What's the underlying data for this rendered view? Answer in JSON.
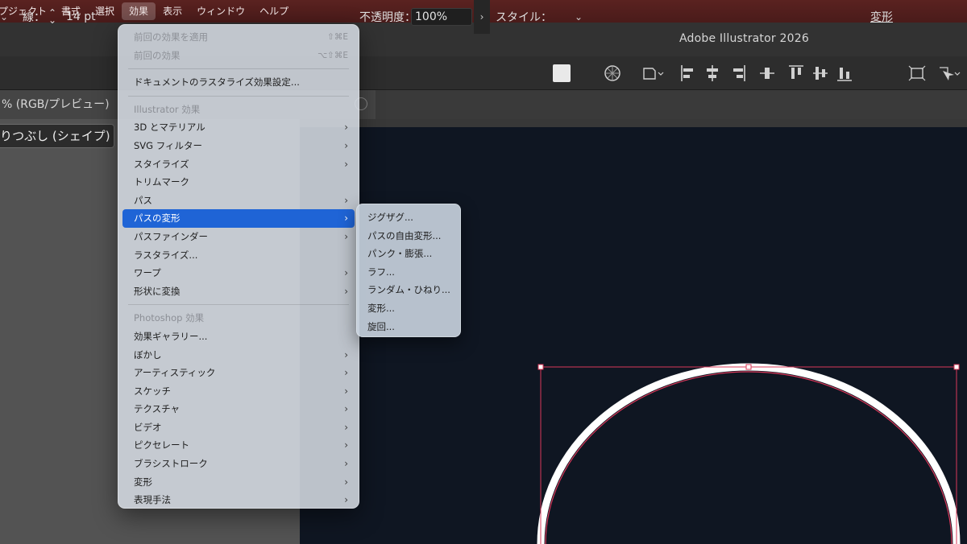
{
  "menubar": {
    "items": [
      {
        "label": "プジェクト",
        "active": false
      },
      {
        "label": "書式",
        "active": false
      },
      {
        "label": "選択",
        "active": false
      },
      {
        "label": "効果",
        "active": true
      },
      {
        "label": "表示",
        "active": false
      },
      {
        "label": "ウィンドウ",
        "active": false
      },
      {
        "label": "ヘルプ",
        "active": false
      }
    ]
  },
  "titlebar": {
    "app_title": "Adobe Illustrator 2026"
  },
  "controlbar": {
    "stroke_label": "線：",
    "stroke_value": "14 pt",
    "opacity_label": "不透明度：",
    "opacity_value": "100%",
    "style_label": "スタイル：",
    "transform_label": "変形"
  },
  "document_tab": {
    "title": "% (RGB/プレビュー)"
  },
  "left_panel": {
    "shape_chip": "りつぶし (シェイプ)"
  },
  "effect_menu": {
    "apply_last": "前回の効果を適用",
    "apply_last_shortcut": "⇧⌘E",
    "last_effect": "前回の効果",
    "last_effect_shortcut": "⌥⇧⌘E",
    "raster_settings": "ドキュメントのラスタライズ効果設定...",
    "illustrator_header": "Illustrator 効果",
    "illustrator_items": [
      {
        "label": "3D とマテリアル",
        "submenu": true
      },
      {
        "label": "SVG フィルター",
        "submenu": true
      },
      {
        "label": "スタイライズ",
        "submenu": true
      },
      {
        "label": "トリムマーク",
        "submenu": false
      },
      {
        "label": "パス",
        "submenu": true
      },
      {
        "label": "パスの変形",
        "submenu": true,
        "active": true
      },
      {
        "label": "パスファインダー",
        "submenu": true
      },
      {
        "label": "ラスタライズ...",
        "submenu": false
      },
      {
        "label": "ワープ",
        "submenu": true
      },
      {
        "label": "形状に変換",
        "submenu": true
      }
    ],
    "photoshop_header": "Photoshop 効果",
    "photoshop_items": [
      {
        "label": "効果ギャラリー...",
        "submenu": false
      },
      {
        "label": "ぼかし",
        "submenu": true
      },
      {
        "label": "アーティスティック",
        "submenu": true
      },
      {
        "label": "スケッチ",
        "submenu": true
      },
      {
        "label": "テクスチャ",
        "submenu": true
      },
      {
        "label": "ビデオ",
        "submenu": true
      },
      {
        "label": "ピクセレート",
        "submenu": true
      },
      {
        "label": "ブラシストローク",
        "submenu": true
      },
      {
        "label": "変形",
        "submenu": true
      },
      {
        "label": "表現手法",
        "submenu": true
      }
    ]
  },
  "submenu": {
    "items": [
      "ジグザグ...",
      "パスの自由変形...",
      "パンク・膨張...",
      "ラフ...",
      "ランダム・ひねり...",
      "変形...",
      "旋回..."
    ]
  },
  "colors": {
    "menubar_bg": "#4a1b1a",
    "canvas_bg": "#0f1622",
    "selection_accent": "#1f64d6",
    "bounding_box": "#d9385a"
  },
  "icons": [
    "chevron-right-icon",
    "chevron-down-icon",
    "stepper-icon",
    "recolor-icon",
    "align-left-icon",
    "align-center-icon",
    "align-right-icon",
    "align-top-icon",
    "align-middle-icon",
    "align-bottom-icon"
  ]
}
